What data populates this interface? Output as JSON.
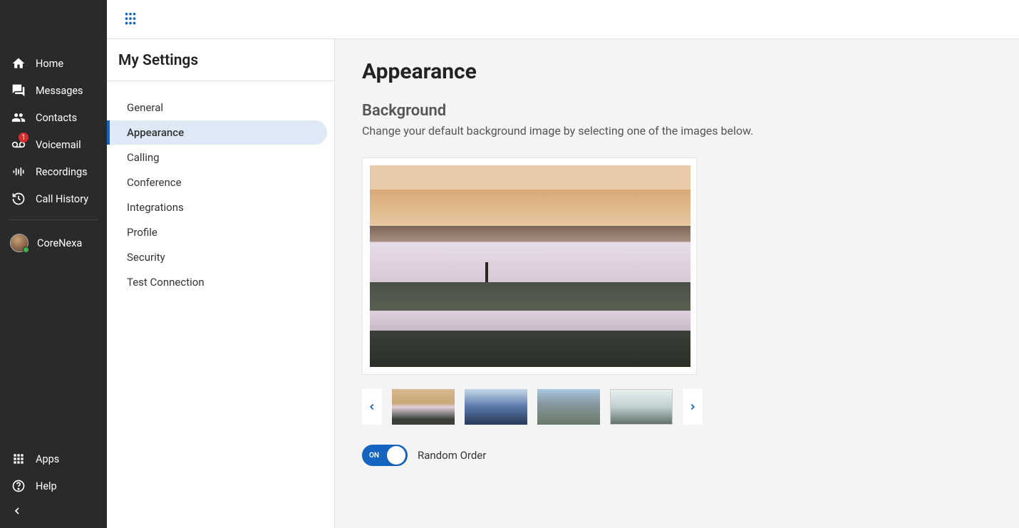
{
  "sidebar": {
    "items": [
      {
        "label": "Home",
        "icon": "home-icon"
      },
      {
        "label": "Messages",
        "icon": "messages-icon"
      },
      {
        "label": "Contacts",
        "icon": "contacts-icon"
      },
      {
        "label": "Voicemail",
        "icon": "voicemail-icon",
        "badge": "1"
      },
      {
        "label": "Recordings",
        "icon": "recordings-icon"
      },
      {
        "label": "Call History",
        "icon": "history-icon"
      }
    ],
    "user_label": "CoreNexa",
    "bottom": [
      {
        "label": "Apps",
        "icon": "apps-icon"
      },
      {
        "label": "Help",
        "icon": "help-icon"
      }
    ]
  },
  "settings": {
    "title": "My Settings",
    "items": [
      {
        "label": "General"
      },
      {
        "label": "Appearance",
        "active": true
      },
      {
        "label": "Calling"
      },
      {
        "label": "Conference"
      },
      {
        "label": "Integrations"
      },
      {
        "label": "Profile"
      },
      {
        "label": "Security"
      },
      {
        "label": "Test Connection"
      }
    ]
  },
  "appearance": {
    "page_title": "Appearance",
    "background_title": "Background",
    "background_desc": "Change your default background image by selecting one of the images below.",
    "toggle_on_text": "ON",
    "random_order_label": "Random Order",
    "random_order_state": true,
    "thumbnails": [
      "thumb-1",
      "thumb-2",
      "thumb-3",
      "thumb-4"
    ]
  },
  "colors": {
    "accent": "#1565c0",
    "sidebar_bg": "#2a2a2a",
    "badge": "#d32f2f",
    "presence": "#3bb54a"
  }
}
